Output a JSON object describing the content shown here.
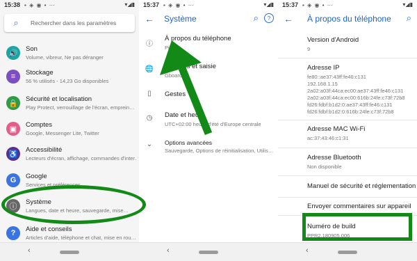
{
  "status": {
    "p1_time": "15:38",
    "p2_time": "15:37",
    "p3_time": "15:37",
    "p1_icons": "▪ ◈ ◉ ▪ ⋯",
    "p2_icons": "▪ ◈ ◉ ▪ ⋯",
    "p3_icons": "▪ ◈ ◉ ▪ ⋯",
    "right_icons": "▾◢▮"
  },
  "panel1": {
    "search_placeholder": "Rechercher dans les paramètres",
    "items": [
      {
        "title": "Son",
        "subtitle": "Volume, vibreur, Ne pas déranger",
        "color": "#1aa5a5",
        "icon": "🔊"
      },
      {
        "title": "Stockage",
        "subtitle": "56 % utilisés - 14,23 Go disponibles",
        "color": "#7b4ec2",
        "icon": "≡"
      },
      {
        "title": "Sécurité et localisation",
        "subtitle": "Play Protect, verrouillage de l'écran, emprein…",
        "color": "#2e9b45",
        "icon": "🔒"
      },
      {
        "title": "Comptes",
        "subtitle": "Google, Messenger Lite, Twitter",
        "color": "#e35d8b",
        "icon": "▣"
      },
      {
        "title": "Accessibilité",
        "subtitle": "Lecteurs d'écran, affichage, commandes d'inter…",
        "color": "#5b2d90",
        "icon": "♿"
      },
      {
        "title": "Google",
        "subtitle": "Services et préférences",
        "color": "#3b73e0",
        "icon": "G"
      },
      {
        "title": "Système",
        "subtitle": "Langues, date et heure, sauvegarde, mise…",
        "color": "#666666",
        "icon": "ⓘ"
      },
      {
        "title": "Aide et conseils",
        "subtitle": "Articles d'aide, téléphone et chat, mise en rou…",
        "color": "#3b73e0",
        "icon": "?"
      }
    ]
  },
  "panel2": {
    "title": "Système",
    "items": [
      {
        "title": "À propos du téléphone",
        "subtitle": "Pixel",
        "icon": "ⓘ"
      },
      {
        "title": "Langues et saisie",
        "subtitle": "Gboard",
        "icon": "🌐"
      },
      {
        "title": "Gestes",
        "subtitle": "",
        "icon": "▯"
      },
      {
        "title": "Date et heure",
        "subtitle": "UTC+02:00 heure d'été d'Europe centrale",
        "icon": "◷"
      },
      {
        "title": "Options avancées",
        "subtitle": "Sauvegarde, Options de réinitialisation, Utilis…",
        "icon": "⌄"
      }
    ]
  },
  "panel3": {
    "title": "À propos du téléphone",
    "items": [
      {
        "title": "Version d'Android",
        "subtitle": "9"
      },
      {
        "title": "Adresse IP",
        "subtitle": "fe80::ae37:43ff:fe46:c131\n192.168.1.15\n2a02:a03f:44ca:ec00:ae37:43ff:fe46:c131\n2a02:a03f:44ca:ec00:616b:24fe:c73f:72b8\nfd26:fdbf:b1d2:0:ae37:43ff:fe46:c131\nfd26:fdbf:b1d2:0:616b:24fe:c73f:72b8"
      },
      {
        "title": "Adresse MAC Wi-Fi",
        "subtitle": "ac:37:43:46:c1:31"
      },
      {
        "title": "Adresse Bluetooth",
        "subtitle": "Non disponible"
      },
      {
        "title": "Manuel de sécurité et réglementation",
        "subtitle": ""
      },
      {
        "title": "Envoyer commentaires sur appareil",
        "subtitle": ""
      },
      {
        "title": "Numéro de build",
        "subtitle": "PPR2.180905.006"
      }
    ]
  },
  "nav": {
    "back": "‹"
  },
  "highlight_color": "#138a17"
}
